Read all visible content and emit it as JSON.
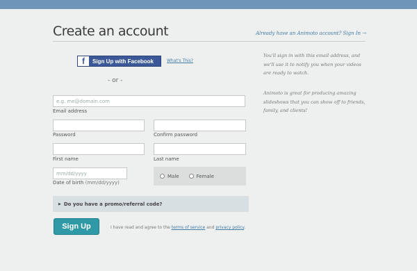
{
  "header": {
    "title": "Create an account",
    "signin_link": "Already have an Animoto account? Sign In →"
  },
  "facebook": {
    "button_label": "Sign Up with Facebook",
    "icon": "f",
    "whats_this": "What's This?"
  },
  "divider": "- or -",
  "form": {
    "email": {
      "placeholder": "e.g. me@domain.com",
      "label": "Email address"
    },
    "password": {
      "label": "Password"
    },
    "confirm_password": {
      "label": "Confirm password"
    },
    "first_name": {
      "label": "First name"
    },
    "last_name": {
      "label": "Last name"
    },
    "dob": {
      "placeholder": "mm/dd/yyyy",
      "label": "Date of birth",
      "label_hint": "(mm/dd/yyyy)"
    },
    "gender": {
      "male": "Male",
      "female": "Female"
    },
    "promo": {
      "arrow": "▶",
      "text": "Do you have a promo/referral code?"
    }
  },
  "footer": {
    "signup_label": "Sign Up",
    "agree_prefix": "I have read and agree to the",
    "terms": "terms of service",
    "and": "and",
    "privacy": "privacy policy",
    "period": "."
  },
  "sidebar": {
    "para1": "You'll sign in with this email address, and we'll use it to notify you when your videos are ready to watch.",
    "para2": "Animoto is great for producing amazing slideshows that you can show off to friends, family, and clients!"
  },
  "colors": {
    "topbar": "#6f96b8",
    "facebook": "#3b5998",
    "signup_button": "#2f9aa6",
    "link": "#3e7ba7"
  }
}
